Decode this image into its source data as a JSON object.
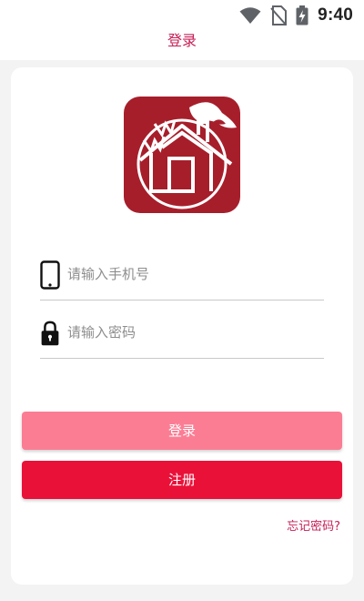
{
  "status_bar": {
    "time": "9:40",
    "icons": [
      "wifi-icon",
      "no-sim-icon",
      "battery-charging-icon"
    ]
  },
  "header": {
    "title": "登录"
  },
  "logo": {
    "icon": "house-logo-icon",
    "color": "#a71e2b"
  },
  "form": {
    "phone": {
      "icon": "phone-icon",
      "placeholder": "请输入手机号",
      "value": ""
    },
    "password": {
      "icon": "lock-icon",
      "placeholder": "请输入密码",
      "value": ""
    }
  },
  "buttons": {
    "login_label": "登录",
    "register_label": "注册"
  },
  "links": {
    "forgot_password": "忘记密码?"
  },
  "colors": {
    "accent": "#c41e54",
    "login_button": "#fb7d94",
    "register_button": "#ea1139"
  }
}
